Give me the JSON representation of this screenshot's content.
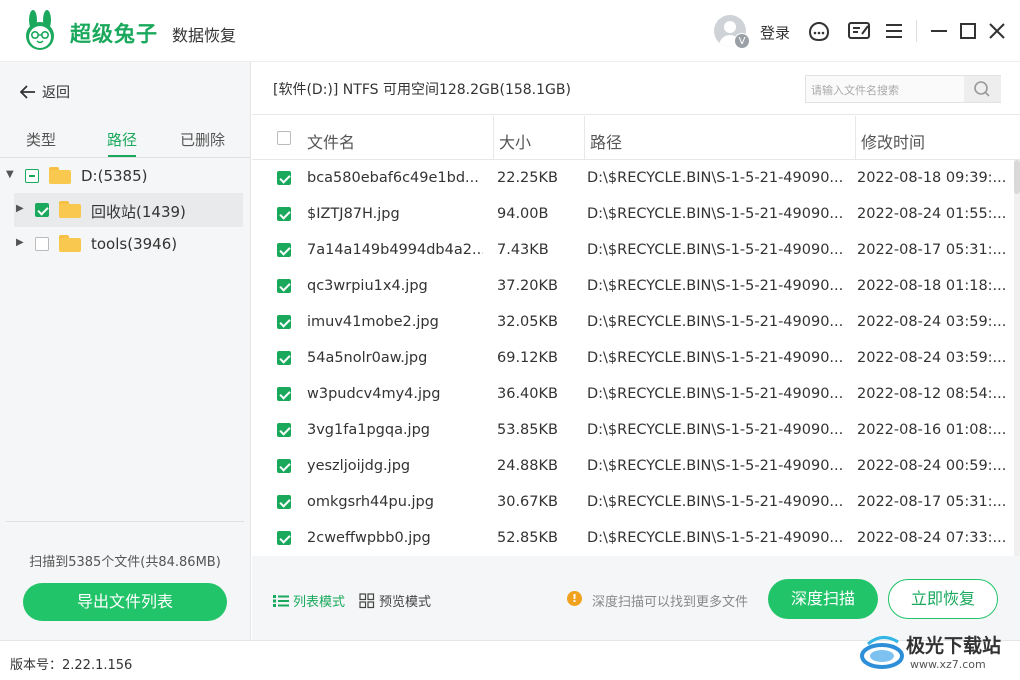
{
  "app": {
    "brand": "超级兔子",
    "subtitle": "数据恢复"
  },
  "header": {
    "login": "登录",
    "vip_badge": "V"
  },
  "sidebar": {
    "back": "返回",
    "tabs": [
      "类型",
      "路径",
      "已删除"
    ],
    "active_tab": "路径",
    "tree": [
      {
        "label": "D:(5385)",
        "state": "partial",
        "expanded": true
      },
      {
        "label": "回收站(1439)",
        "state": "checked",
        "expanded": false
      },
      {
        "label": "tools(3946)",
        "state": "unchecked",
        "expanded": false
      }
    ],
    "scan_summary": "扫描到5385个文件(共84.86MB)",
    "export_button": "导出文件列表"
  },
  "main": {
    "drive_info": "[软件(D:)] NTFS 可用空间128.2GB(158.1GB)",
    "search_placeholder": "请输入文件名搜索",
    "columns": [
      "文件名",
      "大小",
      "路径",
      "修改时间"
    ],
    "rows": [
      {
        "name": "bca580ebaf6c49e1bd...",
        "size": "22.25KB",
        "path": "D:\\$RECYCLE.BIN\\S-1-5-21-49090...",
        "time": "2022-08-18 09:39:..."
      },
      {
        "name": "$IZTJ87H.jpg",
        "size": "94.00B",
        "path": "D:\\$RECYCLE.BIN\\S-1-5-21-49090...",
        "time": "2022-08-24 01:55:..."
      },
      {
        "name": "7a14a149b4994db4a2...",
        "size": "7.43KB",
        "path": "D:\\$RECYCLE.BIN\\S-1-5-21-49090...",
        "time": "2022-08-17 05:31:..."
      },
      {
        "name": "qc3wrpiu1x4.jpg",
        "size": "37.20KB",
        "path": "D:\\$RECYCLE.BIN\\S-1-5-21-49090...",
        "time": "2022-08-18 01:18:..."
      },
      {
        "name": "imuv41mobe2.jpg",
        "size": "32.05KB",
        "path": "D:\\$RECYCLE.BIN\\S-1-5-21-49090...",
        "time": "2022-08-24 03:59:..."
      },
      {
        "name": "54a5nolr0aw.jpg",
        "size": "69.12KB",
        "path": "D:\\$RECYCLE.BIN\\S-1-5-21-49090...",
        "time": "2022-08-24 03:59:..."
      },
      {
        "name": "w3pudcv4my4.jpg",
        "size": "36.40KB",
        "path": "D:\\$RECYCLE.BIN\\S-1-5-21-49090...",
        "time": "2022-08-12 08:54:..."
      },
      {
        "name": "3vg1fa1pgqa.jpg",
        "size": "53.85KB",
        "path": "D:\\$RECYCLE.BIN\\S-1-5-21-49090...",
        "time": "2022-08-16 01:08:..."
      },
      {
        "name": "yeszljoijdg.jpg",
        "size": "24.88KB",
        "path": "D:\\$RECYCLE.BIN\\S-1-5-21-49090...",
        "time": "2022-08-24 00:59:..."
      },
      {
        "name": "omkgsrh44pu.jpg",
        "size": "30.67KB",
        "path": "D:\\$RECYCLE.BIN\\S-1-5-21-49090...",
        "time": "2022-08-17 05:31:..."
      },
      {
        "name": "2cweffwpbb0.jpg",
        "size": "52.85KB",
        "path": "D:\\$RECYCLE.BIN\\S-1-5-21-49090...",
        "time": "2022-08-24 07:33:..."
      }
    ],
    "view_modes": {
      "list": "列表模式",
      "preview": "预览模式",
      "active": "list"
    },
    "hint": "深度扫描可以找到更多文件",
    "deep_scan_button": "深度扫描",
    "recover_button": "立即恢复"
  },
  "statusbar": {
    "version": "版本号：2.22.1.156"
  },
  "watermark": {
    "name": "极光下载站",
    "url": "www.xz7.com"
  },
  "colors": {
    "accent": "#22c46a",
    "accent_text": "#1aa95c",
    "folder": "#f9c84e",
    "warning": "#f0a21f"
  }
}
